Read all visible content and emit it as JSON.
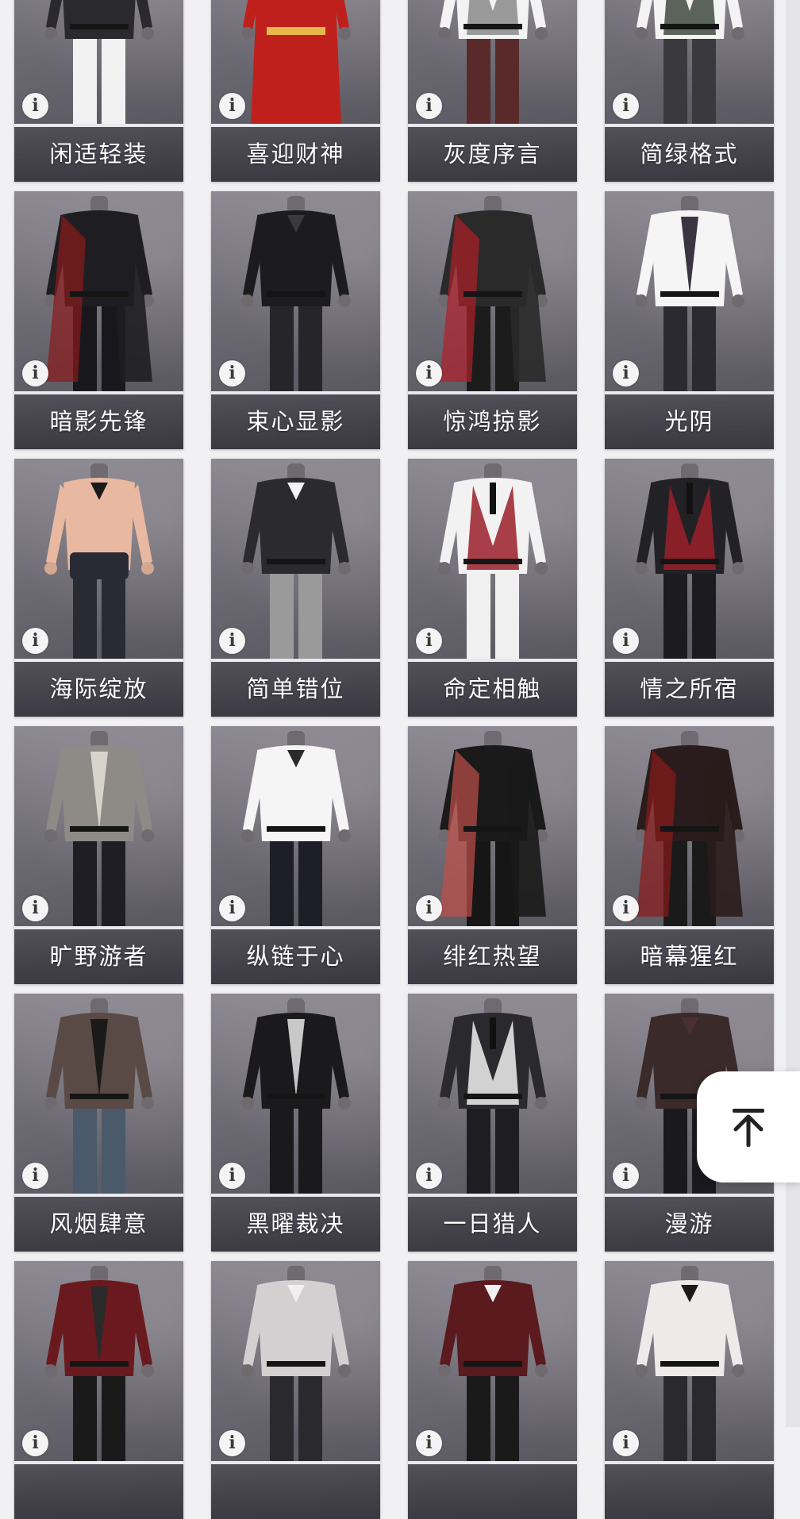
{
  "outfit_grid": {
    "info_icon_glyph": "i",
    "items": [
      {
        "name": "闲适轻装",
        "top": "#2a2a2e",
        "bottom": "#f2f2f2",
        "accent": "#3a3a40",
        "style": "shirt"
      },
      {
        "name": "喜迎财神",
        "top": "#c0201c",
        "bottom": "#b81d1b",
        "accent": "#e8b84a",
        "style": "robe"
      },
      {
        "name": "灰度序言",
        "top": "#f3f3f3",
        "bottom": "#5a2a2a",
        "accent": "#8a8a8a",
        "style": "vest"
      },
      {
        "name": "简绿格式",
        "top": "#f3f3f3",
        "bottom": "#3a3a3e",
        "accent": "#3f4a3f",
        "style": "vest"
      },
      {
        "name": "暗影先锋",
        "top": "#1e1e22",
        "bottom": "#18181c",
        "accent": "#8a1a1a",
        "style": "coat"
      },
      {
        "name": "束心显影",
        "top": "#1c1c1f",
        "bottom": "#26262a",
        "accent": "#3a3a40",
        "style": "shirt"
      },
      {
        "name": "惊鸿掠影",
        "top": "#2a2a2a",
        "bottom": "#1c1c1c",
        "accent": "#b0202a",
        "style": "coat"
      },
      {
        "name": "光阴",
        "top": "#f5f5f5",
        "bottom": "#2a2a30",
        "accent": "#3a3540",
        "style": "jacket"
      },
      {
        "name": "海际绽放",
        "top": "#e8b9a0",
        "bottom": "#2a2a35",
        "accent": "#1a1a1a",
        "style": "bare"
      },
      {
        "name": "简单错位",
        "top": "#2b2b2e",
        "bottom": "#9a9a9a",
        "accent": "#f3f3f3",
        "style": "shirt"
      },
      {
        "name": "命定相触",
        "top": "#f2f2f2",
        "bottom": "#f0f0f0",
        "accent": "#9a1e2a",
        "style": "suit"
      },
      {
        "name": "情之所宿",
        "top": "#222226",
        "bottom": "#1c1c20",
        "accent": "#9a1e2a",
        "style": "suit"
      },
      {
        "name": "旷野游者",
        "top": "#8e8a86",
        "bottom": "#1e1e24",
        "accent": "#d8d4cc",
        "style": "jacket"
      },
      {
        "name": "纵链于心",
        "top": "#f5f5f5",
        "bottom": "#1e1e28",
        "accent": "#2a2a2a",
        "style": "shirt"
      },
      {
        "name": "绯红热望",
        "top": "#1a1a1a",
        "bottom": "#161616",
        "accent": "#c0504a",
        "style": "coat"
      },
      {
        "name": "暗幕猩红",
        "top": "#2a1c1c",
        "bottom": "#1a1a1a",
        "accent": "#8a1a1a",
        "style": "coat"
      },
      {
        "name": "风烟肆意",
        "top": "#5a4a45",
        "bottom": "#4a5a6a",
        "accent": "#1a1a1a",
        "style": "jacket"
      },
      {
        "name": "黑曜裁决",
        "top": "#1a1a1c",
        "bottom": "#1a1a1c",
        "accent": "#c8c8c8",
        "style": "jacket"
      },
      {
        "name": "一日猎人",
        "top": "#2a2a2e",
        "bottom": "#1e1e22",
        "accent": "#f0f0f0",
        "style": "suit"
      },
      {
        "name": "漫游",
        "top": "#3a2a2a",
        "bottom": "#1a1a1e",
        "accent": "#4a3030",
        "style": "shirt"
      },
      {
        "name": "",
        "top": "#6a1a1e",
        "bottom": "#1a1a1a",
        "accent": "#2a2a2a",
        "style": "jacket"
      },
      {
        "name": "",
        "top": "#d2d0d0",
        "bottom": "#2a2a2e",
        "accent": "#f0f0f0",
        "style": "shirt"
      },
      {
        "name": "",
        "top": "#5a1a1e",
        "bottom": "#1a1a1a",
        "accent": "#f0f0f0",
        "style": "shirt"
      },
      {
        "name": "",
        "top": "#eeeaea",
        "bottom": "#2a2a2e",
        "accent": "#1a1a1a",
        "style": "shirt"
      }
    ]
  },
  "scroll_to_top": {
    "icon": "arrow-up-to-line-icon"
  }
}
